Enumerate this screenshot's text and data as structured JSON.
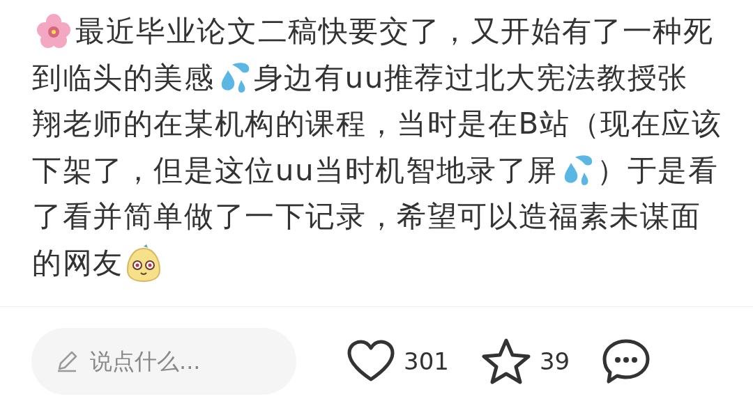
{
  "post": {
    "lines": [
      [
        {
          "kind": "flower"
        },
        {
          "kind": "text",
          "text": "最近毕业论文二稿快要交了，又开始有了一种死"
        }
      ],
      [
        {
          "kind": "text",
          "text": "到临头的美感"
        },
        {
          "kind": "drops"
        },
        {
          "kind": "text",
          "text": "身边有uu推荐过北大宪法教授张"
        }
      ],
      [
        {
          "kind": "text",
          "text": "翔老师的在某机构的课程，当时是在B站（现在应该"
        }
      ],
      [
        {
          "kind": "text",
          "text": "下架了，但是这位uu当时机智地录了屏"
        },
        {
          "kind": "drops"
        },
        {
          "kind": "text",
          "text": "）于是看"
        }
      ],
      [
        {
          "kind": "text",
          "text": "了看并简单做了一下记录，希望可以造福素未谋面"
        }
      ],
      [
        {
          "kind": "text",
          "text": "的网友"
        },
        {
          "kind": "face"
        }
      ]
    ]
  },
  "action_bar": {
    "comment_field": {
      "placeholder": "说点什么..."
    },
    "stats": [
      {
        "kind": "like",
        "count": "301"
      },
      {
        "kind": "collect",
        "count": "39"
      },
      {
        "kind": "comment"
      }
    ]
  }
}
